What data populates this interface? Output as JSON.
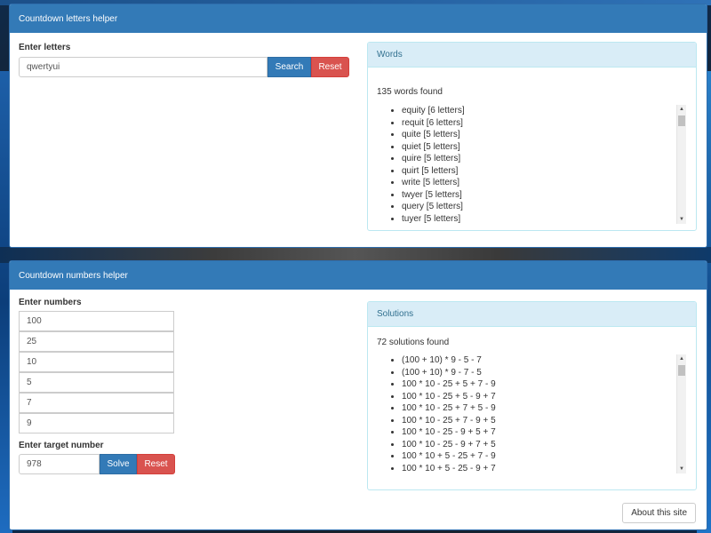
{
  "letters": {
    "title": "Countdown letters helper",
    "input_label": "Enter letters",
    "input_value": "qwertyui",
    "search_label": "Search",
    "reset_label": "Reset",
    "results": {
      "title": "Words",
      "count_text": "135 words found",
      "items": [
        "equity [6 letters]",
        "requit [6 letters]",
        "quite [5 letters]",
        "quiet [5 letters]",
        "quire [5 letters]",
        "quirt [5 letters]",
        "write [5 letters]",
        "twyer [5 letters]",
        "query [5 letters]",
        "tuyer [5 letters]"
      ]
    }
  },
  "numbers": {
    "title": "Countdown numbers helper",
    "input_label": "Enter numbers",
    "values": [
      "100",
      "25",
      "10",
      "5",
      "7",
      "9"
    ],
    "target_label": "Enter target number",
    "target_value": "978",
    "solve_label": "Solve",
    "reset_label": "Reset",
    "results": {
      "title": "Solutions",
      "count_text": "72 solutions found",
      "items": [
        "(100 + 10) * 9 - 5 - 7",
        "(100 + 10) * 9 - 7 - 5",
        "100 * 10 - 25 + 5 + 7 - 9",
        "100 * 10 - 25 + 5 - 9 + 7",
        "100 * 10 - 25 + 7 + 5 - 9",
        "100 * 10 - 25 + 7 - 9 + 5",
        "100 * 10 - 25 - 9 + 5 + 7",
        "100 * 10 - 25 - 9 + 7 + 5",
        "100 * 10 + 5 - 25 + 7 - 9",
        "100 * 10 + 5 - 25 - 9 + 7"
      ]
    }
  },
  "about_label": "About this site",
  "scroll_up_glyph": "▲",
  "scroll_down_glyph": "▼"
}
